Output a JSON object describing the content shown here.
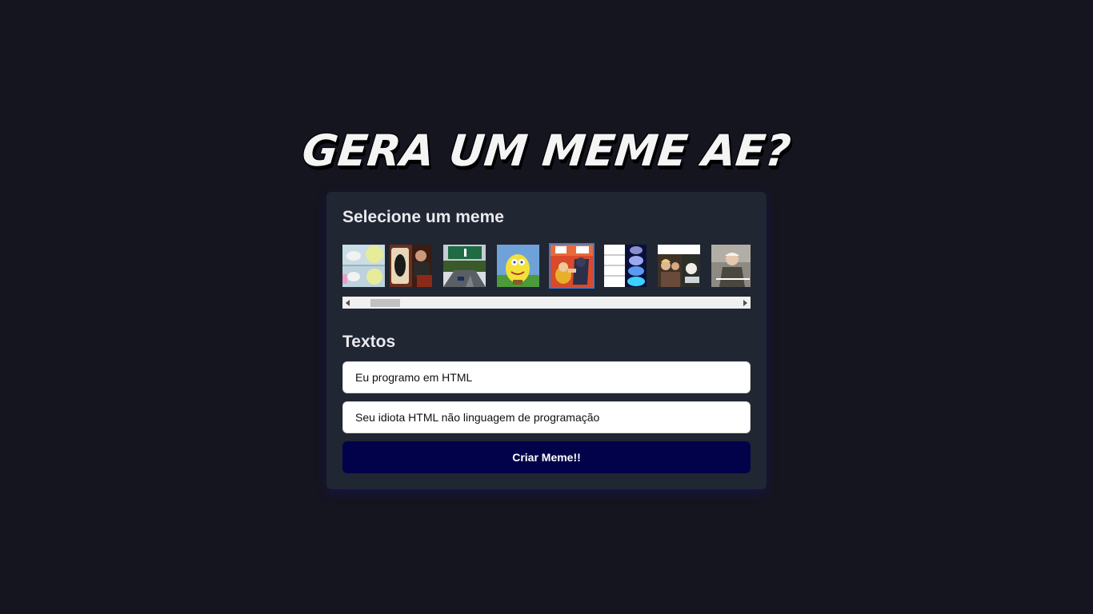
{
  "header": {
    "title": "Gera um meme ae?"
  },
  "meme_selector": {
    "title": "Selecione um meme",
    "selected_index": 4,
    "thumbnails": [
      {
        "name": "meme-thumbnail-1",
        "icon": "comic-panels-icon"
      },
      {
        "name": "meme-thumbnail-2",
        "icon": "uno-card-icon"
      },
      {
        "name": "meme-thumbnail-3",
        "icon": "highway-exit-icon"
      },
      {
        "name": "meme-thumbnail-4",
        "icon": "mocking-spongebob-icon"
      },
      {
        "name": "meme-thumbnail-5",
        "icon": "batman-slapping-robin-icon"
      },
      {
        "name": "meme-thumbnail-6",
        "icon": "expanding-brain-icon"
      },
      {
        "name": "meme-thumbnail-7",
        "icon": "woman-yelling-at-cat-icon"
      },
      {
        "name": "meme-thumbnail-8",
        "icon": "bernie-asking-icon"
      }
    ],
    "scroll_position": 0.1
  },
  "texts": {
    "title": "Textos",
    "inputs": [
      {
        "value": "Eu programo em HTML",
        "placeholder": ""
      },
      {
        "value": "Seu idiota HTML não linguagem de programação",
        "placeholder": ""
      }
    ]
  },
  "actions": {
    "create_label": "Criar Meme!!"
  },
  "colors": {
    "background": "#151520",
    "card": "#202632",
    "button": "#02024a",
    "selected_border": "#3a7bd5"
  }
}
